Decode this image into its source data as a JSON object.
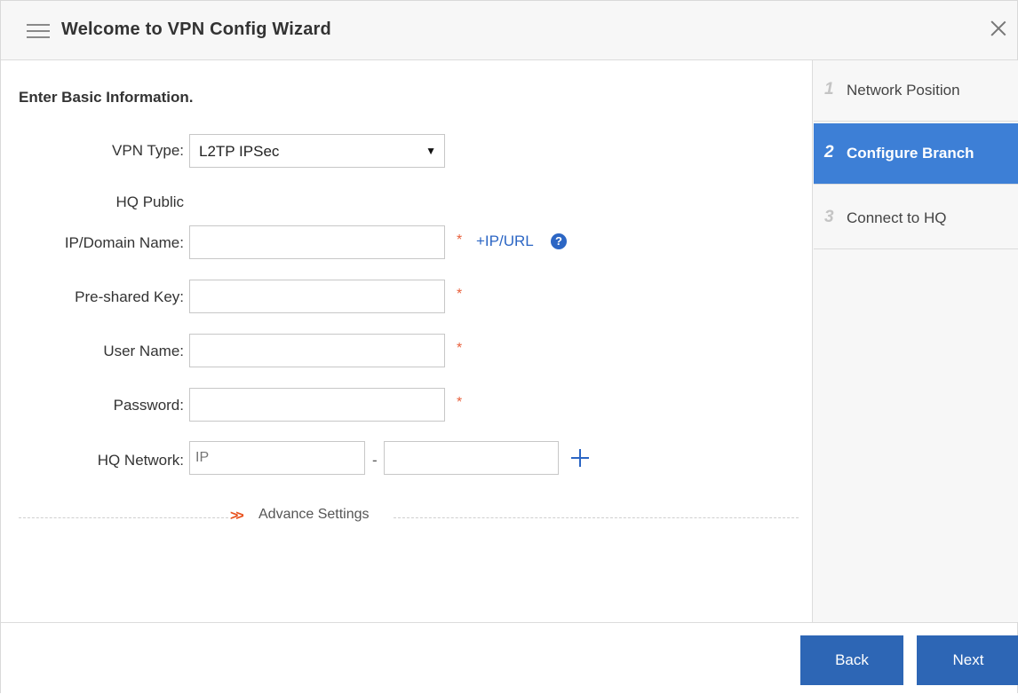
{
  "dialog": {
    "title": "Welcome to VPN Config Wizard"
  },
  "form": {
    "heading": "Enter Basic Information.",
    "vpn_type": {
      "label": "VPN Type:",
      "value": "L2TP IPSec"
    },
    "hq_public": {
      "label_line1": "HQ Public",
      "label_line2": "IP/Domain Name:",
      "value": "",
      "required": "*",
      "add_link": "+IP/URL",
      "help_icon": "?"
    },
    "pre_shared_key": {
      "label": "Pre-shared Key:",
      "value": "",
      "required": "*"
    },
    "user_name": {
      "label": "User Name:",
      "value": "",
      "required": "*"
    },
    "password": {
      "label": "Password:",
      "value": "",
      "required": "*"
    },
    "hq_network": {
      "label": "HQ Network:",
      "ip_placeholder": "IP",
      "separator": "-",
      "mask_value": ""
    },
    "advance_settings": {
      "chevron": ">>",
      "label": "Advance Settings"
    }
  },
  "steps": [
    {
      "number": "1",
      "label": "Network Position",
      "active": false
    },
    {
      "number": "2",
      "label": "Configure Branch",
      "active": true
    },
    {
      "number": "3",
      "label": "Connect to HQ",
      "active": false
    }
  ],
  "footer": {
    "back_label": "Back",
    "next_label": "Next"
  },
  "colors": {
    "accent": "#3d7fd6",
    "button": "#2d66b5",
    "link": "#2c66c4",
    "required": "#e8603c"
  },
  "icons": {
    "menu": "hamburger-menu-icon",
    "close": "close-icon",
    "help": "question-circle-icon",
    "add": "plus-icon",
    "expand": "double-chevron-right-icon"
  }
}
